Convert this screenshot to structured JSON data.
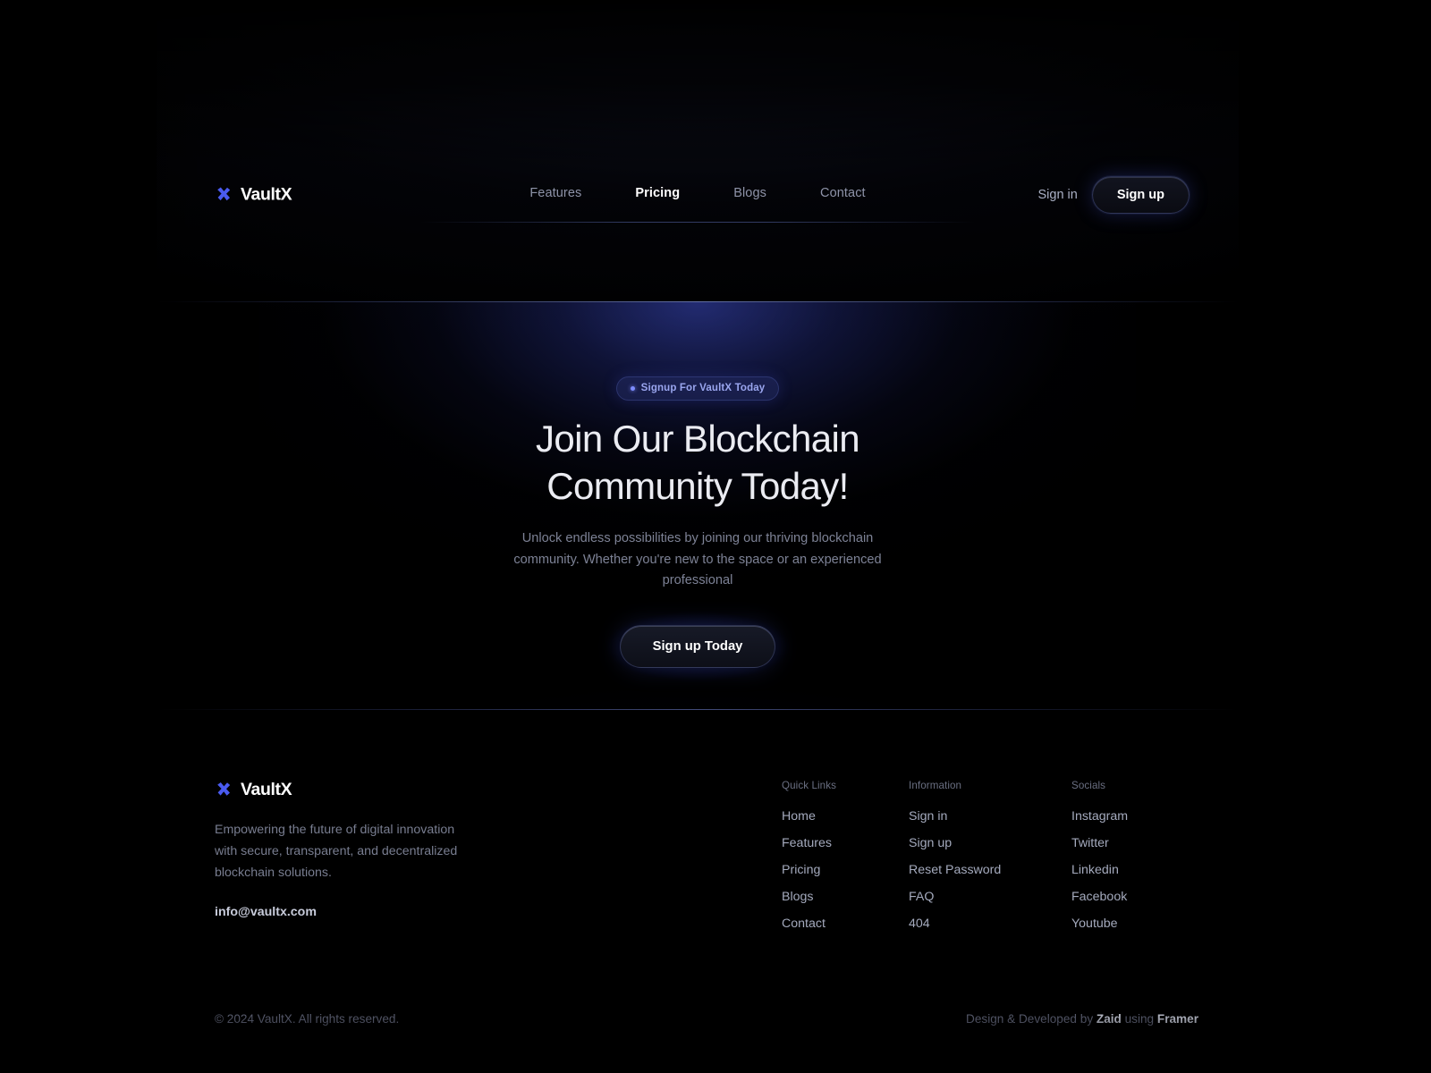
{
  "brand": {
    "name": "VaultX",
    "logo_icon": "x-mark-icon",
    "accent_color": "#4a5bf0"
  },
  "nav": {
    "links": [
      {
        "label": "Features",
        "active": false
      },
      {
        "label": "Pricing",
        "active": true
      },
      {
        "label": "Blogs",
        "active": false
      },
      {
        "label": "Contact",
        "active": false
      }
    ],
    "sign_in_label": "Sign in",
    "sign_up_label": "Sign up"
  },
  "hero": {
    "badge": "Signup For VaultX Today",
    "badge_dot_color": "#7d8dff",
    "title_line1": "Join Our Blockchain",
    "title_line2": "Community Today!",
    "subtitle": "Unlock endless possibilities by joining our thriving blockchain community. Whether you're new to the space or an experienced professional",
    "cta_label": "Sign up Today"
  },
  "footer": {
    "brand_name": "VaultX",
    "description": "Empowering the future of digital innovation with secure, transparent, and decentralized blockchain solutions.",
    "email": "info@vaultx.com",
    "columns": [
      {
        "title": "Quick Links",
        "links": [
          "Home",
          "Features",
          "Pricing",
          "Blogs",
          "Contact"
        ]
      },
      {
        "title": "Information",
        "links": [
          "Sign in",
          "Sign up",
          "Reset Password",
          "FAQ",
          "404"
        ]
      },
      {
        "title": "Socials",
        "links": [
          "Instagram",
          "Twitter",
          "Linkedin",
          "Facebook",
          "Youtube"
        ]
      }
    ],
    "copyright": "© 2024 VaultX. All rights reserved.",
    "credit_prefix": "Design & Developed by ",
    "credit_author": "Zaid",
    "credit_middle": " using ",
    "credit_platform": "Framer"
  }
}
